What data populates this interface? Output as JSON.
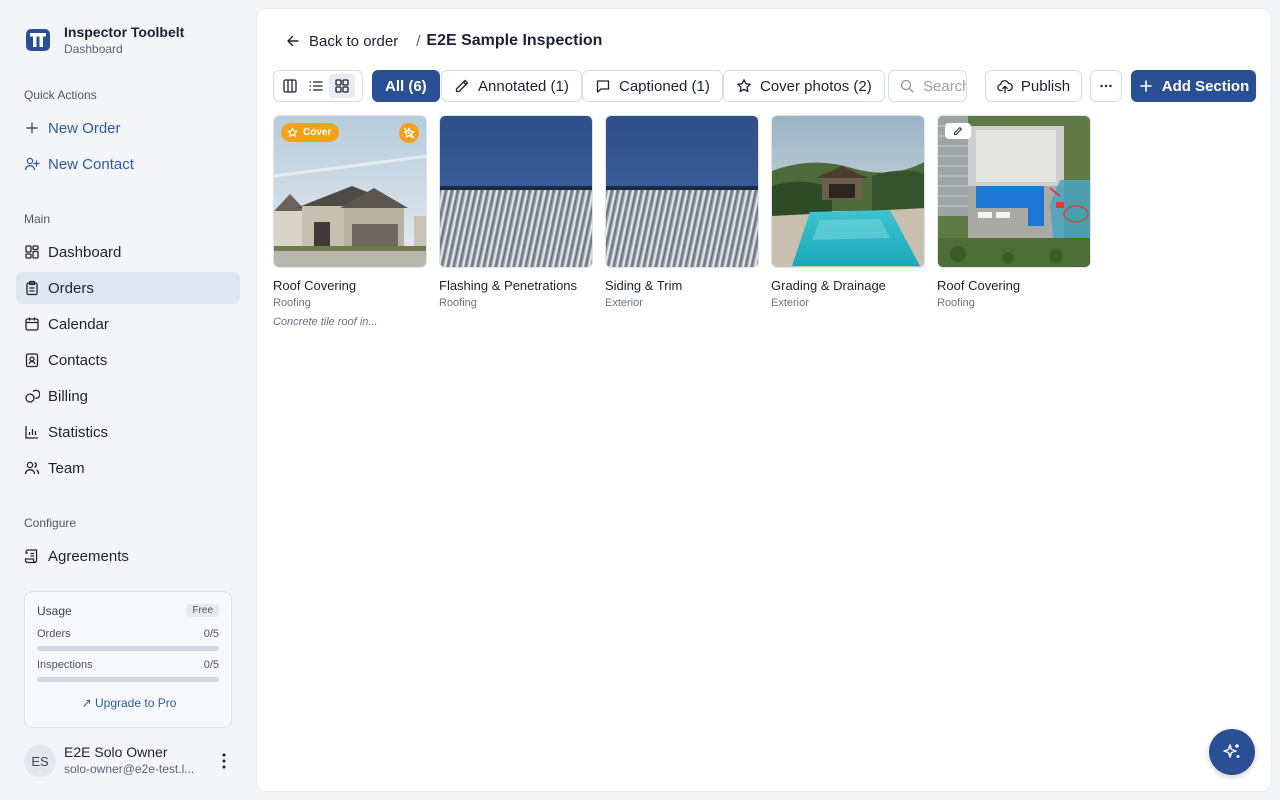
{
  "colors": {
    "primary": "#2b4f95",
    "cover_badge": "#f5a01a",
    "active_nav_bg": "#dfe6f2"
  },
  "brand": {
    "name": "Inspector Toolbelt",
    "subtitle": "Dashboard",
    "logo_icon": "toolbelt-logo"
  },
  "sidebar": {
    "quick_actions_label": "Quick Actions",
    "quick_actions": [
      {
        "label": "New Order",
        "icon": "plus-icon"
      },
      {
        "label": "New Contact",
        "icon": "user-plus-icon"
      }
    ],
    "main_label": "Main",
    "main_items": [
      {
        "label": "Dashboard",
        "icon": "dashboard-icon"
      },
      {
        "label": "Orders",
        "icon": "clipboard-icon",
        "active": true
      },
      {
        "label": "Calendar",
        "icon": "calendar-icon"
      },
      {
        "label": "Contacts",
        "icon": "contact-card-icon"
      },
      {
        "label": "Billing",
        "icon": "coins-icon"
      },
      {
        "label": "Statistics",
        "icon": "bar-chart-icon"
      },
      {
        "label": "Team",
        "icon": "users-icon"
      }
    ],
    "configure_label": "Configure",
    "configure_items": [
      {
        "label": "Agreements",
        "icon": "scroll-icon"
      }
    ]
  },
  "usage": {
    "title": "Usage",
    "plan_badge": "Free",
    "rows": [
      {
        "label": "Orders",
        "count": "0/5",
        "fraction": 0
      },
      {
        "label": "Inspections",
        "count": "0/5",
        "fraction": 0
      }
    ],
    "upgrade_label": "Upgrade to Pro"
  },
  "user": {
    "initials": "ES",
    "name": "E2E Solo Owner",
    "email": "solo-owner@e2e-test.l..."
  },
  "header": {
    "back_label": "Back to order",
    "separator": "/",
    "title": "E2E Sample Inspection"
  },
  "toolbar": {
    "view_modes": [
      "columns-view-icon",
      "list-view-icon",
      "grid-view-icon"
    ],
    "active_view": "grid-view-icon",
    "filters": [
      {
        "label": "All (6)",
        "active": true
      },
      {
        "label": "Annotated (1)",
        "icon": "pencil-icon"
      },
      {
        "label": "Captioned (1)",
        "icon": "message-square-icon"
      },
      {
        "label": "Cover photos (2)",
        "icon": "star-icon"
      }
    ],
    "search_placeholder": "Search",
    "publish_label": "Publish",
    "more_icon": "ellipsis-icon",
    "add_section_label": "Add Section"
  },
  "photos": [
    {
      "title": "Roof Covering",
      "category": "Roofing",
      "caption": "Concrete tile roof in...",
      "cover": true,
      "cover_badge": "Cover",
      "scene": "house"
    },
    {
      "title": "Flashing & Penetrations",
      "category": "Roofing",
      "scene": "metal-siding"
    },
    {
      "title": "Siding & Trim",
      "category": "Exterior",
      "scene": "metal-siding"
    },
    {
      "title": "Grading & Drainage",
      "category": "Exterior",
      "scene": "pool"
    },
    {
      "title": "Roof Covering",
      "category": "Roofing",
      "annotated": true,
      "scene": "aerial"
    }
  ],
  "fab_icon": "sparkles-icon"
}
